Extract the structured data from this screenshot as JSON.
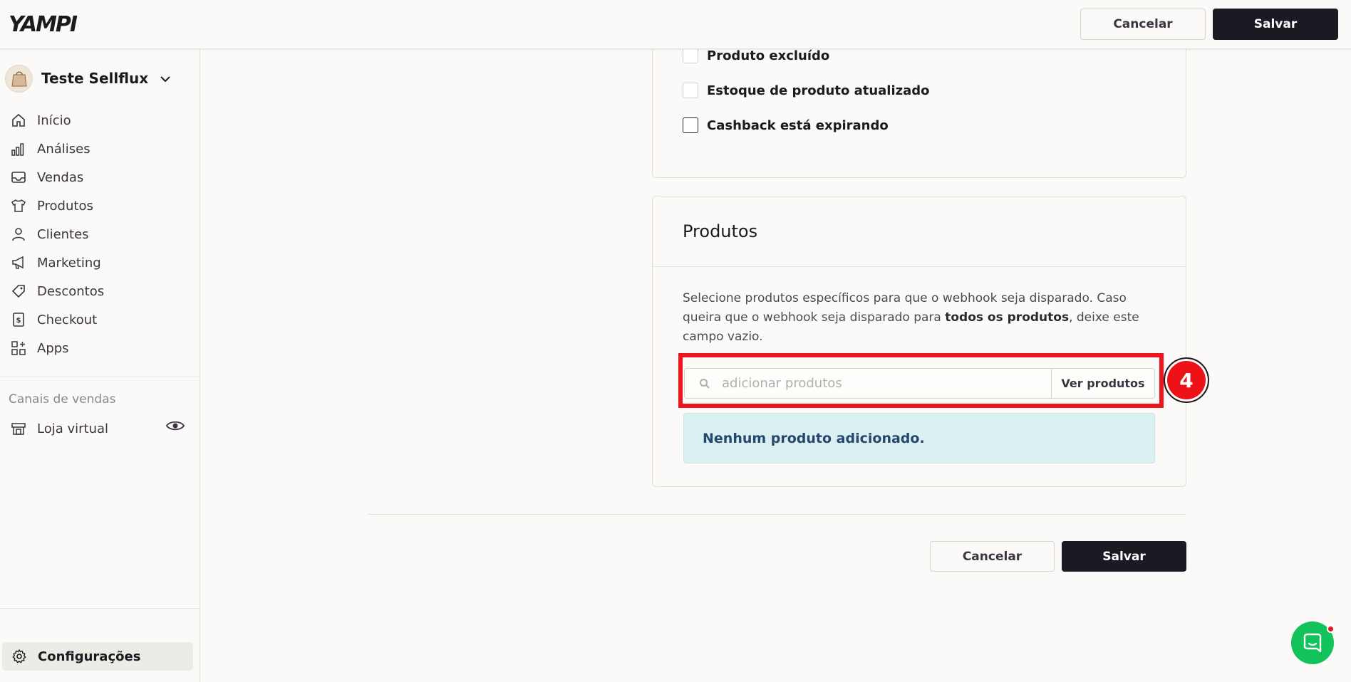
{
  "brand": {
    "logo_text": "YAMPI"
  },
  "header": {
    "cancel_label": "Cancelar",
    "save_label": "Salvar"
  },
  "sidebar": {
    "store_name": "Teste Sellflux",
    "items": [
      {
        "label": "Início",
        "icon": "home-icon"
      },
      {
        "label": "Análises",
        "icon": "bar-chart-icon"
      },
      {
        "label": "Vendas",
        "icon": "inbox-icon"
      },
      {
        "label": "Produtos",
        "icon": "shirt-icon"
      },
      {
        "label": "Clientes",
        "icon": "user-icon"
      },
      {
        "label": "Marketing",
        "icon": "megaphone-icon"
      },
      {
        "label": "Descontos",
        "icon": "tag-icon"
      },
      {
        "label": "Checkout",
        "icon": "receipt-icon"
      },
      {
        "label": "Apps",
        "icon": "apps-icon"
      }
    ],
    "section_label": "Canais de vendas",
    "channel_label": "Loja virtual",
    "settings_label": "Configurações"
  },
  "events": {
    "items": [
      {
        "label": "Produto excluído",
        "checked": false
      },
      {
        "label": "Estoque de produto atualizado",
        "checked": false
      },
      {
        "label": "Cashback está expirando",
        "checked": false
      }
    ]
  },
  "products": {
    "title": "Produtos",
    "description_part1": "Selecione produtos específicos para que o webhook seja disparado. Caso queira que o webhook seja disparado para ",
    "description_bold": "todos os produtos",
    "description_part2": ", deixe este campo vazio.",
    "search_placeholder": "adicionar produtos",
    "view_button": "Ver produtos",
    "empty_message": "Nenhum produto adicionado."
  },
  "annotation": {
    "step_number": "4"
  },
  "footer": {
    "cancel_label": "Cancelar",
    "save_label": "Salvar"
  },
  "colors": {
    "primary_dark": "#1d1923",
    "highlight_red": "#f0141e",
    "alert_bg": "#daf0f1",
    "alert_text": "#25466e",
    "chat_green": "#12c25a"
  }
}
